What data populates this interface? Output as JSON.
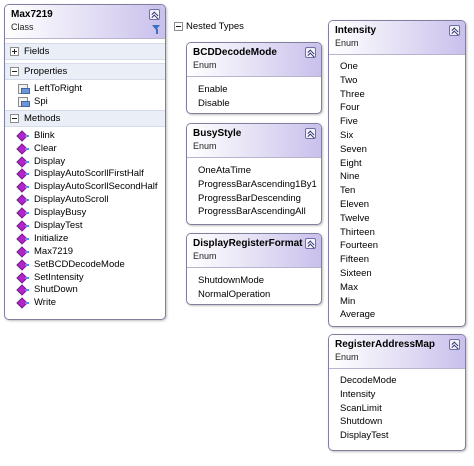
{
  "max7219": {
    "title": "Max7219",
    "kind": "Class",
    "sections": {
      "fields": "Fields",
      "properties": "Properties",
      "methods": "Methods"
    },
    "properties": [
      "LeftToRight",
      "Spi"
    ],
    "methods": [
      "Blink",
      "Clear",
      "Display",
      "DisplayAutoScorllFirstHalf",
      "DisplayAutoScorllSecondHalf",
      "DisplayAutoScroll",
      "DisplayBusy",
      "DisplayTest",
      "Initialize",
      "Max7219",
      "SetBCDDecodeMode",
      "SetIntensity",
      "ShutDown",
      "Write"
    ]
  },
  "nested_types_label": "Nested Types",
  "enums": {
    "bcd": {
      "title": "BCDDecodeMode",
      "kind": "Enum",
      "values": [
        "Enable",
        "Disable"
      ]
    },
    "busy": {
      "title": "BusyStyle",
      "kind": "Enum",
      "values": [
        "OneAtaTime",
        "ProgressBarAscending1By1",
        "ProgressBarDescending",
        "ProgressBarAscendingAll"
      ]
    },
    "drf": {
      "title": "DisplayRegisterFormat",
      "kind": "Enum",
      "values": [
        "ShutdownMode",
        "NormalOperation"
      ]
    },
    "intensity": {
      "title": "Intensity",
      "kind": "Enum",
      "values": [
        "One",
        "Two",
        "Three",
        "Four",
        "Five",
        "Six",
        "Seven",
        "Eight",
        "Nine",
        "Ten",
        "Eleven",
        "Twelve",
        "Thirteen",
        "Fourteen",
        "Fifteen",
        "Sixteen",
        "Max",
        "Min",
        "Average"
      ]
    },
    "ram": {
      "title": "RegisterAddressMap",
      "kind": "Enum",
      "values": [
        "DecodeMode",
        "Intensity",
        "ScanLimit",
        "Shutdown",
        "DisplayTest"
      ]
    }
  }
}
